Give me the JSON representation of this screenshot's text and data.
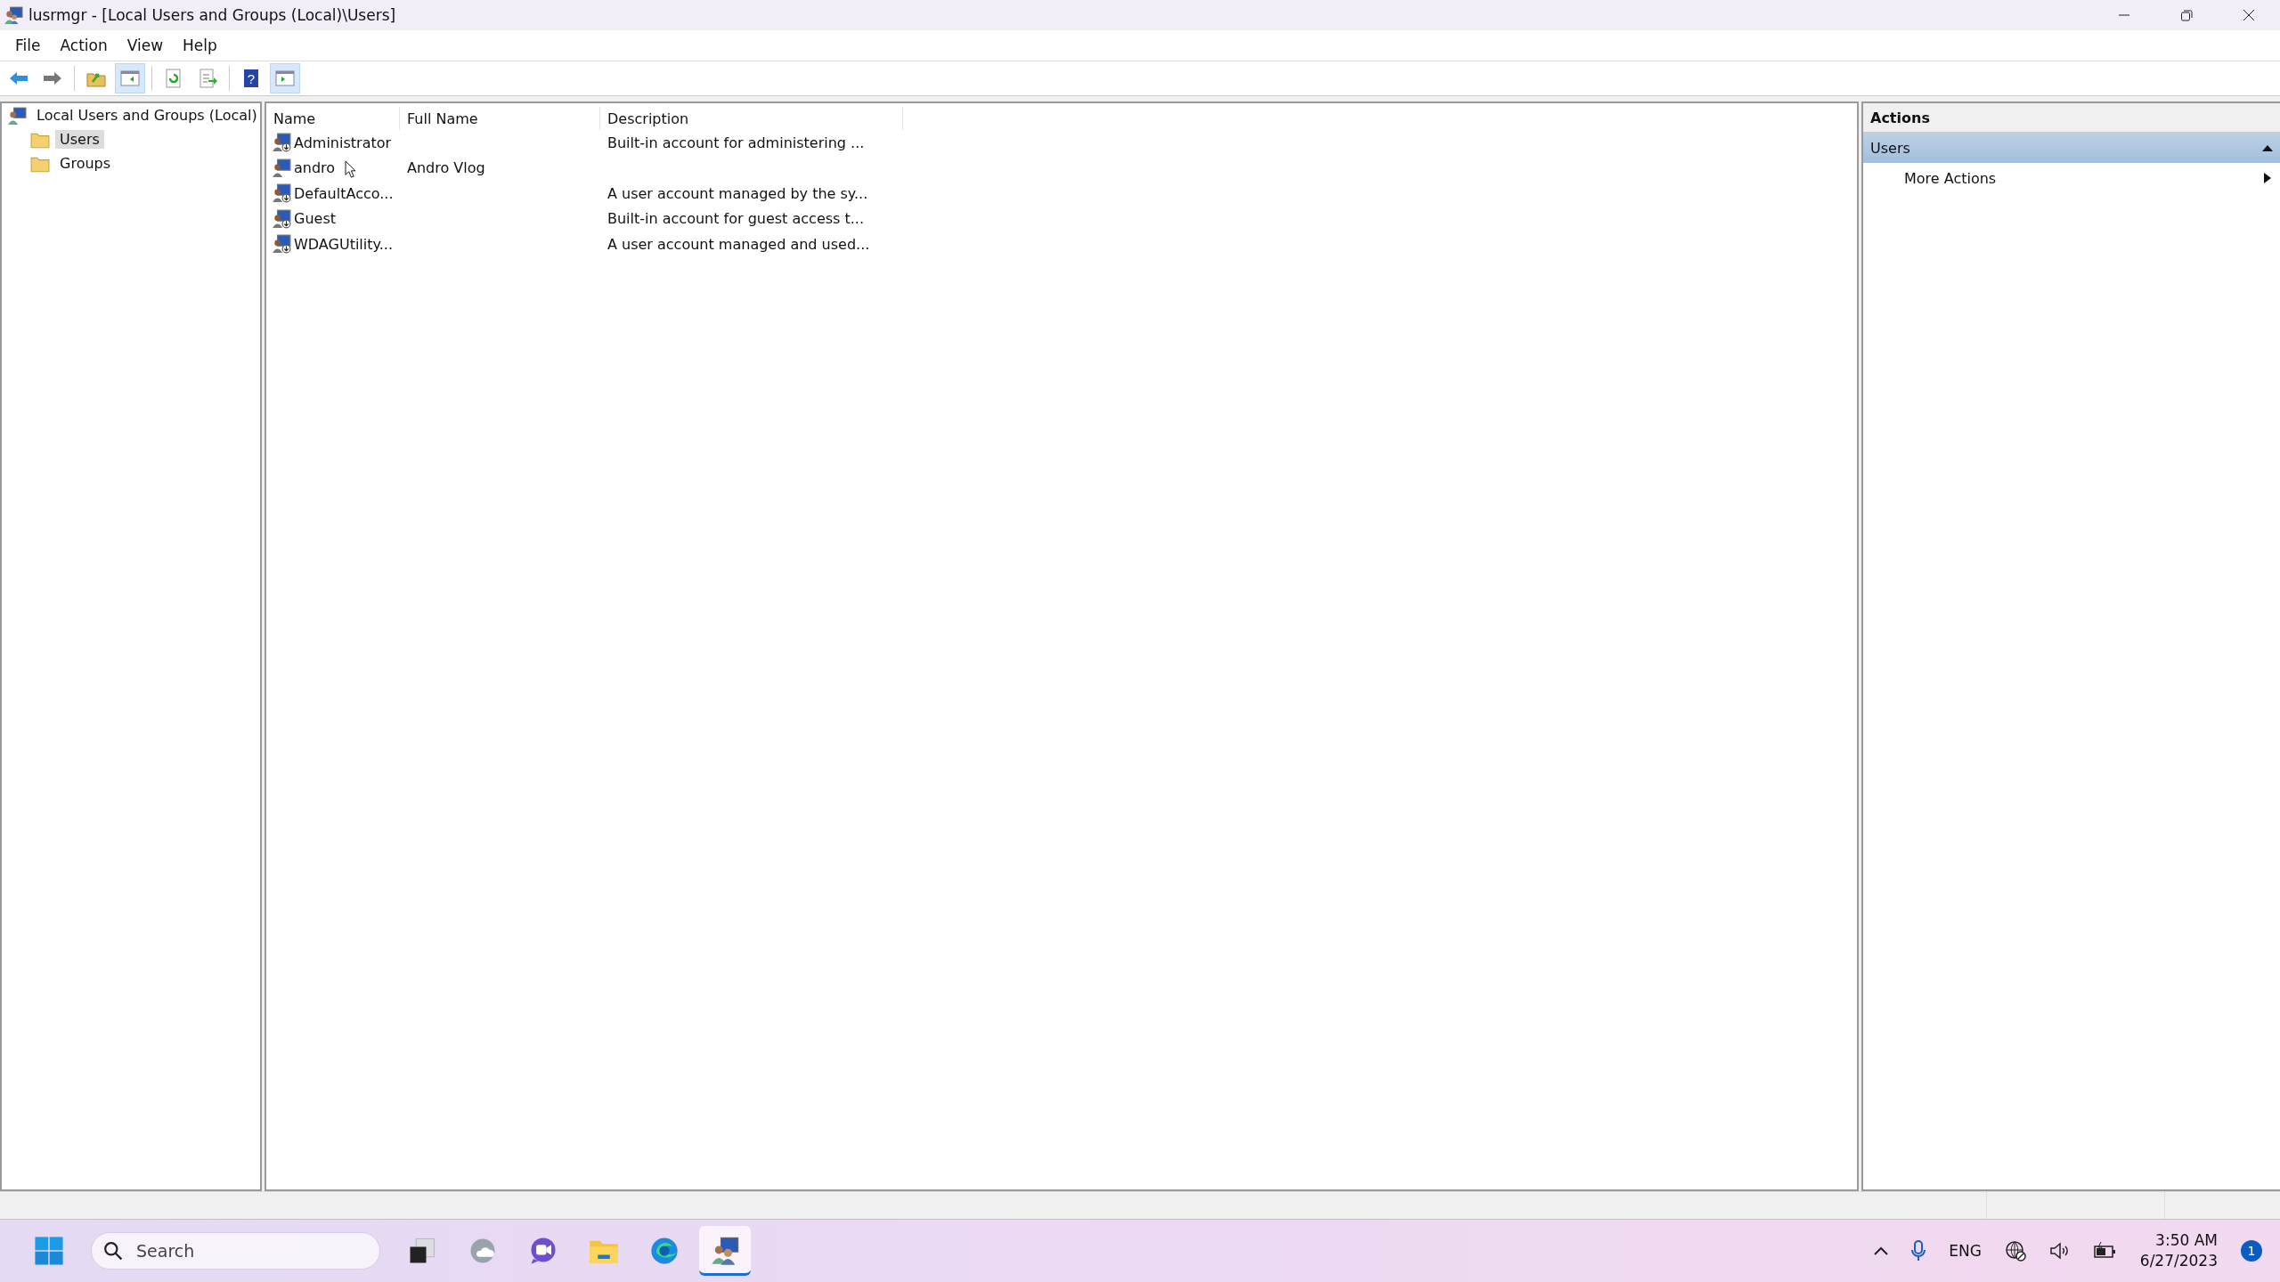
{
  "window": {
    "title": "lusrmgr - [Local Users and Groups (Local)\\Users]"
  },
  "menu": [
    "File",
    "Action",
    "View",
    "Help"
  ],
  "toolbar": [
    {
      "kind": "back",
      "on": false
    },
    {
      "kind": "forward",
      "on": false
    },
    {
      "kind": "up",
      "on": false
    },
    {
      "kind": "tree",
      "on": true
    },
    {
      "kind": "refresh",
      "on": false
    },
    {
      "kind": "export",
      "on": false
    },
    {
      "kind": "help",
      "on": false,
      "label": "?"
    },
    {
      "kind": "actionpane",
      "on": true
    }
  ],
  "tree": {
    "label": "Local Users and Groups (Local)",
    "children": [
      {
        "label": "Users",
        "selected": true
      },
      {
        "label": "Groups",
        "selected": false
      }
    ]
  },
  "list": {
    "columns": [
      "Name",
      "Full Name",
      "Description"
    ],
    "rows": [
      {
        "name": "Administrator",
        "full_name": "",
        "description": "Built-in account for administering ..."
      },
      {
        "name": "andro",
        "full_name": "Andro Vlog",
        "description": ""
      },
      {
        "name": "DefaultAcco...",
        "full_name": "",
        "description": "A user account managed by the sy..."
      },
      {
        "name": "Guest",
        "full_name": "",
        "description": "Built-in account for guest access t..."
      },
      {
        "name": "WDAGUtility...",
        "full_name": "",
        "description": "A user account managed and used..."
      }
    ]
  },
  "actions": {
    "title": "Actions",
    "sections": [
      {
        "label": "Users",
        "expanded": true,
        "items": [
          "More Actions"
        ]
      }
    ]
  },
  "taskbar": {
    "search": {
      "placeholder": "Search"
    },
    "apps": [
      {
        "kind": "taskview",
        "active": false
      },
      {
        "kind": "widgets",
        "active": false
      },
      {
        "kind": "chat",
        "active": false
      },
      {
        "kind": "explorer",
        "active": false
      },
      {
        "kind": "edge",
        "active": false
      },
      {
        "kind": "users",
        "active": true
      }
    ],
    "language": "ENG",
    "time": "3:50 AM",
    "date": "6/27/2023",
    "notifications": "1"
  }
}
